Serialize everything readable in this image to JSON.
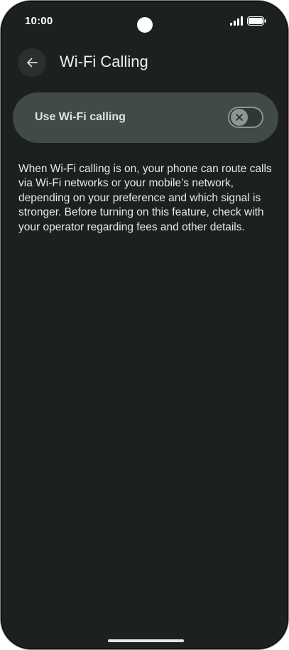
{
  "status_bar": {
    "time": "10:00",
    "icons": [
      "signal-icon",
      "battery-icon"
    ]
  },
  "app_bar": {
    "back_icon": "arrow-back-icon",
    "title": "Wi-Fi Calling"
  },
  "wifi_calling_toggle": {
    "label": "Use Wi-Fi calling",
    "state": "off",
    "thumb_icon": "close-icon"
  },
  "description": "When Wi-Fi calling is on, your phone can route calls via Wi-Fi networks or your mobile’s network, depending on your preference and which signal is stronger. Before turning on this feature, check with your operator regarding fees and other details.",
  "colors": {
    "background": "#1c201e",
    "card": "#414b46",
    "switch_off": "#8e9691"
  }
}
